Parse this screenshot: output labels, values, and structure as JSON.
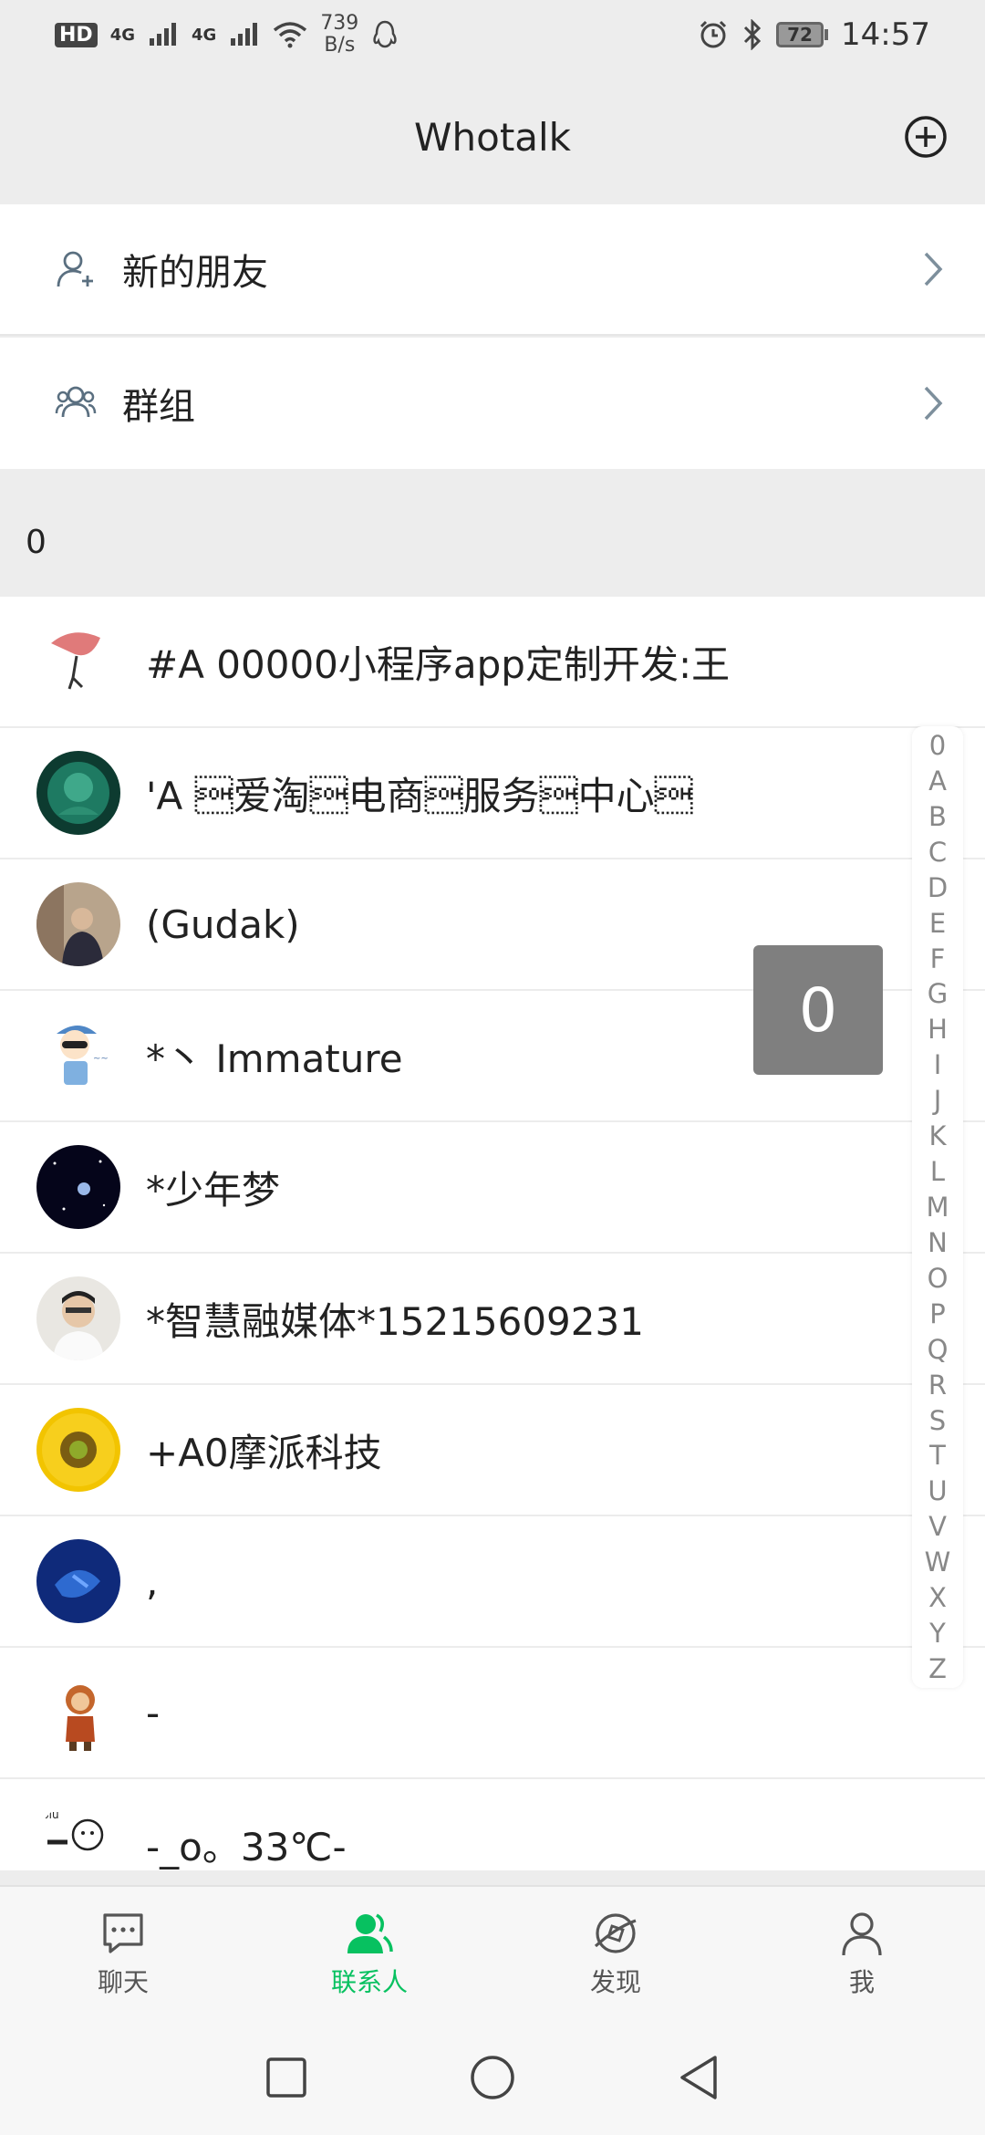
{
  "status_bar": {
    "hd": "HD",
    "net1": "4G",
    "net2": "4G",
    "speed_value": "739",
    "speed_unit": "B/s",
    "battery": "72",
    "time": "14:57"
  },
  "header": {
    "title": "Whotalk",
    "add_icon": "plus-circle-icon"
  },
  "menu": {
    "new_friends": "新的朋友",
    "groups": "群组"
  },
  "section": {
    "letter": "0"
  },
  "contacts": [
    {
      "name": "#A 00000小程序app定制开发:王",
      "avatar": "red-figure"
    },
    {
      "name": "'A \u0001爱淘\u0001电商\u0001服务\u0001中心\u0001",
      "avatar": "jade-carving"
    },
    {
      "name": "(Gudak)",
      "avatar": "man-photo"
    },
    {
      "name": "*丶 Immature",
      "avatar": "cartoon-boy"
    },
    {
      "name": "*少年梦",
      "avatar": "night-sky"
    },
    {
      "name": "*智慧融媒体*15215609231",
      "avatar": "man-glasses"
    },
    {
      "name": "+A0摩派科技",
      "avatar": "sunflower"
    },
    {
      "name": ",",
      "avatar": "blue-abstract"
    },
    {
      "name": "-",
      "avatar": "monkey-king"
    },
    {
      "name": "-_o。33℃-",
      "avatar": "doodle"
    }
  ],
  "index_letters": [
    "0",
    "A",
    "B",
    "C",
    "D",
    "E",
    "F",
    "G",
    "H",
    "I",
    "J",
    "K",
    "L",
    "M",
    "N",
    "O",
    "P",
    "Q",
    "R",
    "S",
    "T",
    "U",
    "V",
    "W",
    "X",
    "Y",
    "Z"
  ],
  "index_bubble": "0",
  "tabs": [
    {
      "label": "聊天",
      "icon": "chat-icon"
    },
    {
      "label": "联系人",
      "icon": "contacts-icon"
    },
    {
      "label": "发现",
      "icon": "discover-icon"
    },
    {
      "label": "我",
      "icon": "me-icon"
    }
  ],
  "colors": {
    "accent": "#07c160",
    "background": "#ededed"
  }
}
